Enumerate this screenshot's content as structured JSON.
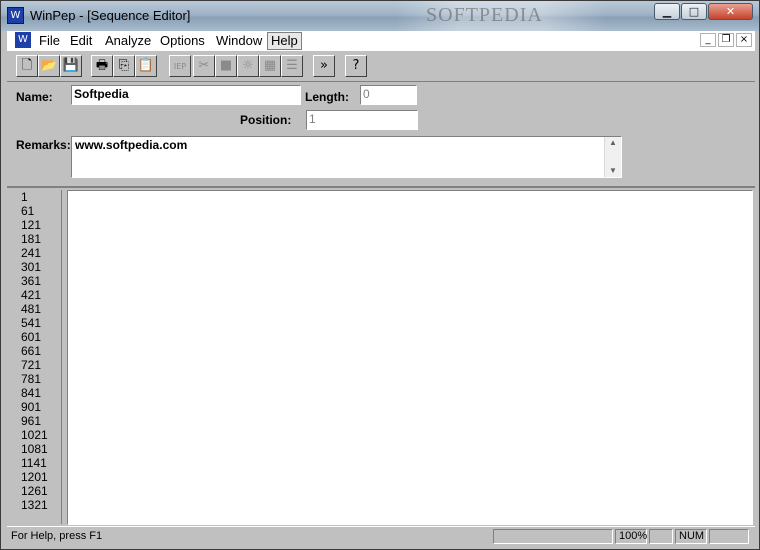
{
  "window": {
    "title": "WinPep - [Sequence Editor]",
    "watermark": "SOFTPEDIA",
    "caption_buttons": [
      "minimize-icon",
      "maximize-icon",
      "close-icon"
    ]
  },
  "menu": {
    "items": [
      "File",
      "Edit",
      "Analyze",
      "Options",
      "Window",
      "Help"
    ],
    "highlighted": "Help",
    "mdi_buttons": [
      "minimize-icon",
      "restore-icon",
      "close-icon"
    ]
  },
  "toolbar": {
    "buttons": [
      {
        "name": "new-icon",
        "glyph": "🗋",
        "enabled": true
      },
      {
        "name": "open-icon",
        "glyph": "📂",
        "enabled": true
      },
      {
        "name": "save-icon",
        "glyph": "💾",
        "enabled": true
      },
      {
        "name": "print-icon",
        "glyph": "🖶",
        "enabled": true
      },
      {
        "name": "copy-icon",
        "glyph": "⎘",
        "enabled": true
      },
      {
        "name": "paste-icon",
        "glyph": "📋",
        "enabled": true
      },
      {
        "name": "iep-icon",
        "glyph": "IEP",
        "enabled": false
      },
      {
        "name": "cut-icon",
        "glyph": "✂",
        "enabled": false
      },
      {
        "name": "block-icon",
        "glyph": "■",
        "enabled": false
      },
      {
        "name": "sun-icon",
        "glyph": "☼",
        "enabled": false
      },
      {
        "name": "grid-icon",
        "glyph": "▦",
        "enabled": false
      },
      {
        "name": "list-icon",
        "glyph": "☰",
        "enabled": false
      },
      {
        "name": "forward-icon",
        "glyph": "»",
        "enabled": true
      },
      {
        "name": "help-icon",
        "glyph": "?",
        "enabled": true
      }
    ]
  },
  "form": {
    "name_label": "Name:",
    "name_value": "Softpedia",
    "length_label": "Length:",
    "length_value": "0",
    "position_label": "Position:",
    "position_value": "1",
    "remarks_label": "Remarks:",
    "remarks_value": "www.softpedia.com"
  },
  "editor": {
    "line_numbers": [
      "1",
      "61",
      "121",
      "181",
      "241",
      "301",
      "361",
      "421",
      "481",
      "541",
      "601",
      "661",
      "721",
      "781",
      "841",
      "901",
      "961",
      "1021",
      "1081",
      "1141",
      "1201",
      "1261",
      "1321"
    ]
  },
  "status": {
    "help_text": "For Help, press F1",
    "zoom": "100%",
    "num": "NUM"
  }
}
